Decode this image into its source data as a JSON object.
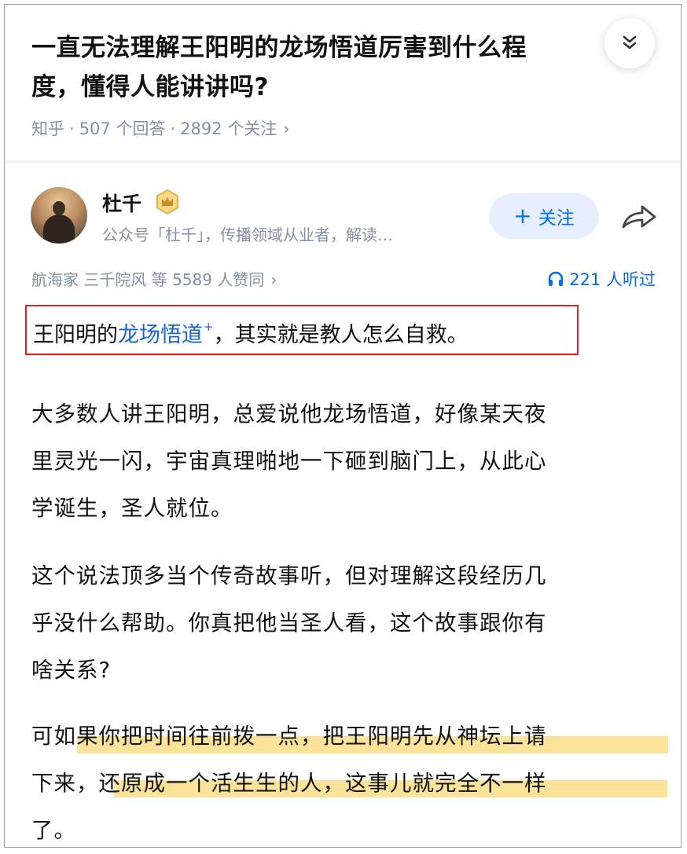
{
  "question": {
    "title": "一直无法理解王阳明的龙场悟道厉害到什么程\n度，懂得人能讲讲吗?",
    "source": "知乎",
    "answers": "507 个回答",
    "followers": "2892 个关注",
    "separator": "·",
    "chevron": "›"
  },
  "collapse_icon": "chevron-double-down-icon",
  "author": {
    "name": "杜千",
    "badge_icon": "crown-badge-icon",
    "bio": "公众号「杜千」，传播领域从业者，解读…",
    "follow_label": "关注",
    "follow_plus": "+",
    "share_icon": "share-icon"
  },
  "answer_meta": {
    "voters": "航海家 三千院风 等 5589 人赞同",
    "chevron": "›",
    "listen_count": "221 人听过",
    "listen_icon": "headphones-icon"
  },
  "content": {
    "lead_prefix": "王阳明的",
    "lead_link": "龙场悟道",
    "lead_link_mark": "+",
    "lead_suffix": "，其实就是教人怎么自救。",
    "paragraphs": [
      "大多数人讲王阳明，总爱说他龙场悟道，好像某天夜\n里灵光一闪，宇宙真理啪地一下砸到脑门上，从此心\n学诞生，圣人就位。",
      "这个说法顶多当个传奇故事听，但对理解这段经历几\n乎没什么帮助。你真把他当圣人看，这个故事跟你有\n啥关系?",
      "可如果你把时间往前拨一点，把王阳明先从神坛上请\n下来，还原成一个活生生的人，这事儿就完全不一样\n了。"
    ]
  },
  "colors": {
    "accent": "#056de8",
    "link": "#1865d6",
    "meta_gray": "#8590a6",
    "red_box": "#e02020",
    "marker_yellow": "#fbe39a"
  }
}
